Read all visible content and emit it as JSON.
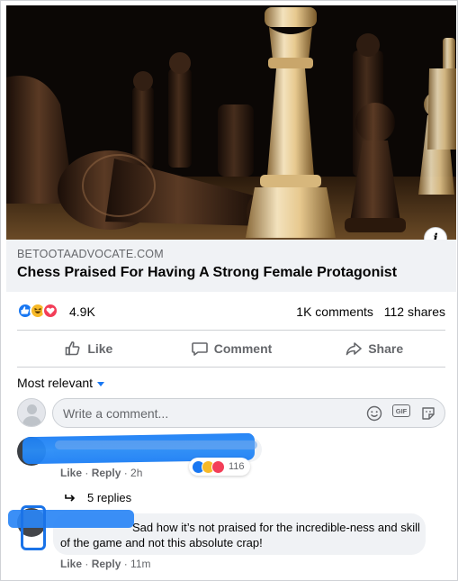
{
  "article": {
    "domain": "BETOOTAADVOCATE.COM",
    "headline": "Chess Praised For Having A Strong Female Protagonist",
    "info_glyph": "i"
  },
  "stats": {
    "reactions_count": "4.9K",
    "comments": "1K comments",
    "shares": "112 shares",
    "reaction_icons": [
      "like-icon",
      "haha-icon",
      "love-icon"
    ]
  },
  "actions": {
    "like": "Like",
    "comment": "Comment",
    "share": "Share"
  },
  "comments_filter": "Most relevant",
  "composer": {
    "placeholder": "Write a comment...",
    "gif_label": "GIF"
  },
  "comments": [
    {
      "author": "",
      "text": "",
      "like": "Like",
      "reply": "Reply",
      "time": "2h",
      "reaction_count": "116",
      "replies_label": "5 replies"
    },
    {
      "author": "",
      "text": "Sad how it’s not praised for the incredible-ness and skill of the game and not this absolute crap!",
      "like": "Like",
      "reply": "Reply",
      "time": "11m"
    }
  ],
  "colors": {
    "accent": "#1877f2",
    "like": "#1877f2",
    "haha": "#f7b928",
    "love": "#f33e58",
    "secondary_text": "#65676b",
    "preview_bg": "#f0f2f5",
    "redaction_scribble": "#2a86f5"
  }
}
